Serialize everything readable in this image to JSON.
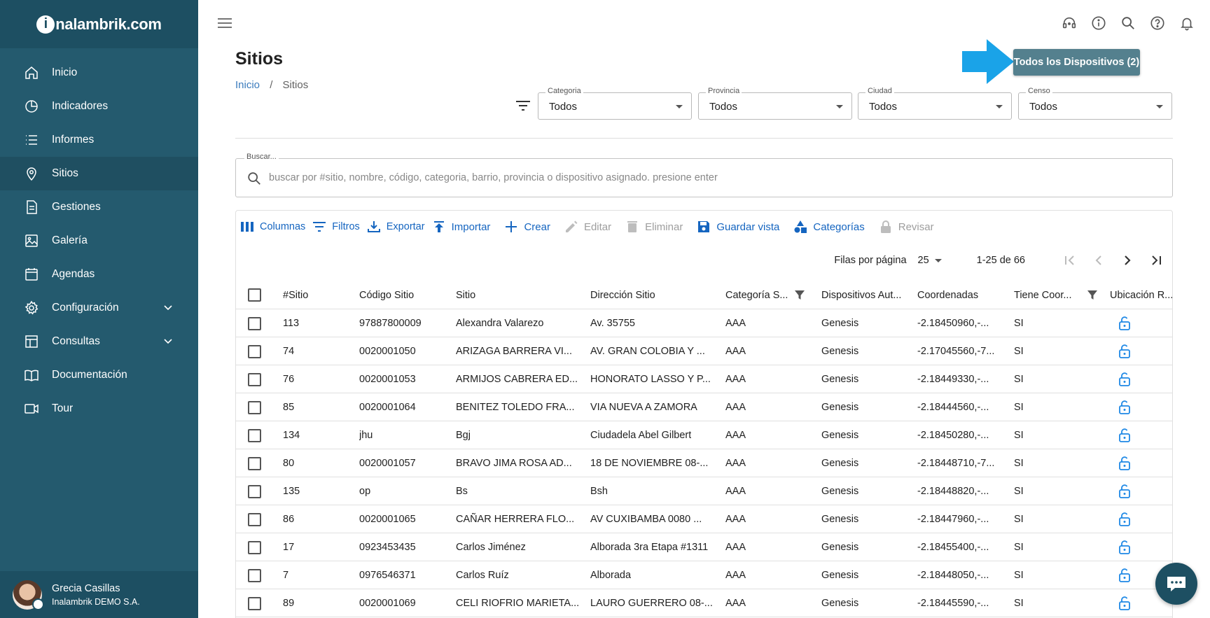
{
  "brand": {
    "logo_i": "i",
    "logo_rest": "nalambrik.com"
  },
  "sidebar": {
    "items": [
      {
        "label": "Inicio",
        "icon": "home-icon"
      },
      {
        "label": "Indicadores",
        "icon": "pie-chart-icon"
      },
      {
        "label": "Informes",
        "icon": "list-icon"
      },
      {
        "label": "Sitios",
        "icon": "location-pin-icon",
        "active": true
      },
      {
        "label": "Gestiones",
        "icon": "document-icon"
      },
      {
        "label": "Galería",
        "icon": "image-icon"
      },
      {
        "label": "Agendas",
        "icon": "calendar-icon"
      },
      {
        "label": "Configuración",
        "icon": "gear-icon",
        "expandable": true
      },
      {
        "label": "Consultas",
        "icon": "table-icon",
        "expandable": true
      },
      {
        "label": "Documentación",
        "icon": "book-icon"
      },
      {
        "label": "Tour",
        "icon": "video-icon"
      }
    ],
    "user": {
      "name": "Grecia Casillas",
      "org": "Inalambrik DEMO S.A."
    }
  },
  "page": {
    "title": "Sitios",
    "breadcrumb": {
      "home": "Inicio",
      "sep": "/",
      "current": "Sitios"
    },
    "devices_button": "Todos los Dispositivos (2)"
  },
  "filters": [
    {
      "label": "Categoria",
      "value": "Todos"
    },
    {
      "label": "Provincia",
      "value": "Todos"
    },
    {
      "label": "Ciudad",
      "value": "Todos"
    },
    {
      "label": "Censo",
      "value": "Todos"
    }
  ],
  "search": {
    "label": "Buscar...",
    "placeholder": "buscar por #sitio, nombre, código, categoria, barrio, provincia o dispositivo asignado. presione enter"
  },
  "toolbar": {
    "columnas": "Columnas",
    "filtros": "Filtros",
    "exportar": "Exportar",
    "importar": "Importar",
    "crear": "Crear",
    "editar": "Editar",
    "eliminar": "Eliminar",
    "guardar": "Guardar vista",
    "categorias": "Categorías",
    "revisar": "Revisar"
  },
  "pagination": {
    "rows_label": "Filas por página",
    "rows_value": "25",
    "range": "1-25 de 66"
  },
  "colors": {
    "sidebar": "#245a6e",
    "accent": "#1565c0",
    "arrow": "#1aa3e8",
    "devices_btn": "#54808e"
  },
  "table": {
    "columns": [
      "#Sitio",
      "Código Sitio",
      "Sitio",
      "Dirección Sitio",
      "Categoría S...",
      "Dispositivos Aut...",
      "Coordenadas",
      "Tiene Coor...",
      "Ubicación R..."
    ],
    "rows": [
      [
        "113",
        "97887800009",
        "Alexandra Valarezo",
        "Av. 35755",
        "AAA",
        "Genesis",
        "-2.18450960,-...",
        "SI"
      ],
      [
        "74",
        "0020001050",
        "ARIZAGA BARRERA VI...",
        "AV. GRAN COLOBIA Y ...",
        "AAA",
        "Genesis",
        "-2.17045560,-7...",
        "SI"
      ],
      [
        "76",
        "0020001053",
        "ARMIJOS CABRERA ED...",
        "HONORATO LASSO Y P...",
        "AAA",
        "Genesis",
        "-2.18449330,-...",
        "SI"
      ],
      [
        "85",
        "0020001064",
        "BENITEZ TOLEDO FRA...",
        "VIA NUEVA A ZAMORA",
        "AAA",
        "Genesis",
        "-2.18444560,-...",
        "SI"
      ],
      [
        "134",
        "jhu",
        "Bgj",
        "Ciudadela Abel Gilbert",
        "AAA",
        "Genesis",
        "-2.18450280,-...",
        "SI"
      ],
      [
        "80",
        "0020001057",
        "BRAVO JIMA ROSA AD...",
        "18 DE NOVIEMBRE 08-...",
        "AAA",
        "Genesis",
        "-2.18448710,-7...",
        "SI"
      ],
      [
        "135",
        "op",
        "Bs",
        "Bsh",
        "AAA",
        "Genesis",
        "-2.18448820,-...",
        "SI"
      ],
      [
        "86",
        "0020001065",
        "CAÑAR HERRERA FLO...",
        "AV CUXIBAMBA 0080 ...",
        "AAA",
        "Genesis",
        "-2.18447960,-...",
        "SI"
      ],
      [
        "17",
        "0923453435",
        "Carlos Jiménez",
        "Alborada 3ra Etapa #1311",
        "AAA",
        "Genesis",
        "-2.18455400,-...",
        "SI"
      ],
      [
        "7",
        "0976546371",
        "Carlos Ruíz",
        "Alborada",
        "AAA",
        "Genesis",
        "-2.18448050,-...",
        "SI"
      ],
      [
        "89",
        "0020001069",
        "CELI RIOFRIO MARIETA...",
        "LAURO GUERRERO 08-...",
        "AAA",
        "Genesis",
        "-2.18445590,-...",
        "SI"
      ]
    ]
  }
}
